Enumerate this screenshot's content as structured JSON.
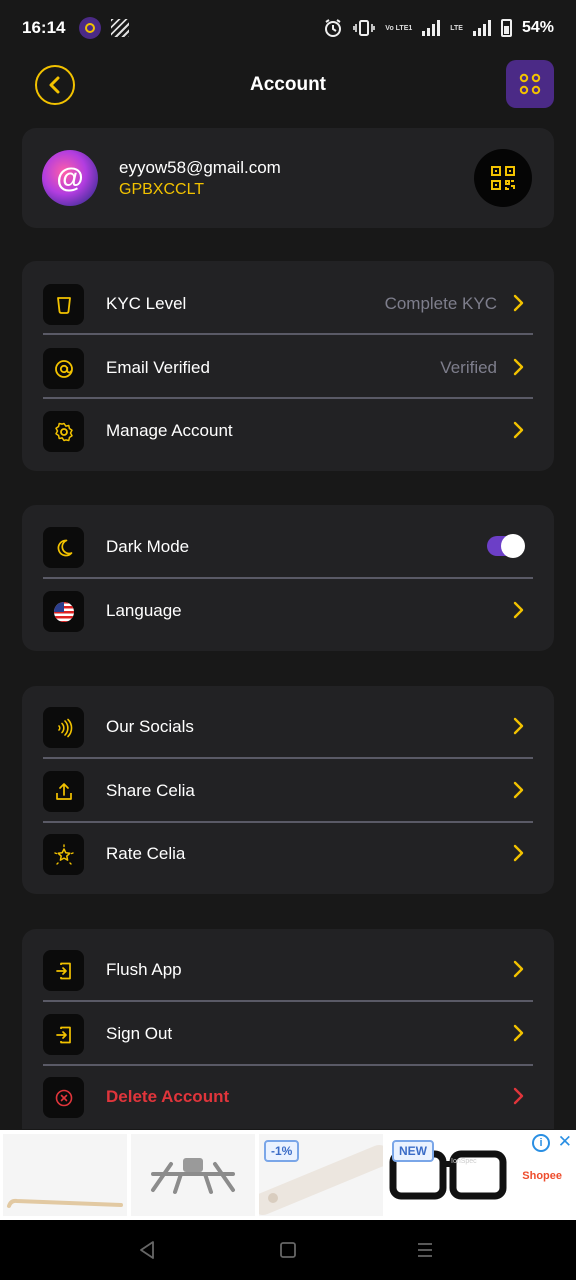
{
  "status_bar": {
    "time": "16:14",
    "battery": "54%",
    "network_small": "Vo LTE1",
    "network_small2": "LTE"
  },
  "header": {
    "title": "Account",
    "back_icon": "chevron-left-icon",
    "menu_icon": "grid-dots-icon"
  },
  "profile": {
    "email": "eyyow58@gmail.com",
    "uid": "GPBXCCLT",
    "avatar_symbol": "@"
  },
  "sections": {
    "verification": [
      {
        "icon": "shield-icon",
        "label": "KYC Level",
        "value": "Complete KYC"
      },
      {
        "icon": "at-sign-icon",
        "label": "Email Verified",
        "value": "Verified"
      },
      {
        "icon": "gear-icon",
        "label": "Manage Account",
        "value": ""
      }
    ],
    "preferences": [
      {
        "icon": "moon-icon",
        "label": "Dark Mode",
        "toggle": true
      },
      {
        "icon": "us-flag-icon",
        "label": "Language"
      }
    ],
    "social": [
      {
        "icon": "sound-waves-icon",
        "label": "Our Socials"
      },
      {
        "icon": "share-icon",
        "label": "Share Celia"
      },
      {
        "icon": "star-icon",
        "label": "Rate Celia"
      }
    ],
    "danger": [
      {
        "icon": "exit-icon",
        "label": "Flush App"
      },
      {
        "icon": "exit-icon",
        "label": "Sign Out"
      },
      {
        "icon": "x-circle-icon",
        "label": "Delete Account"
      }
    ]
  },
  "ad": {
    "badges": [
      "-1%",
      "NEW"
    ],
    "brand": "Shopee",
    "tile_caption": "IonSpec"
  },
  "colors": {
    "accent": "#f2c200",
    "purple": "#4b2a86",
    "danger": "#e0353b",
    "card": "#222224",
    "background": "#181818"
  }
}
